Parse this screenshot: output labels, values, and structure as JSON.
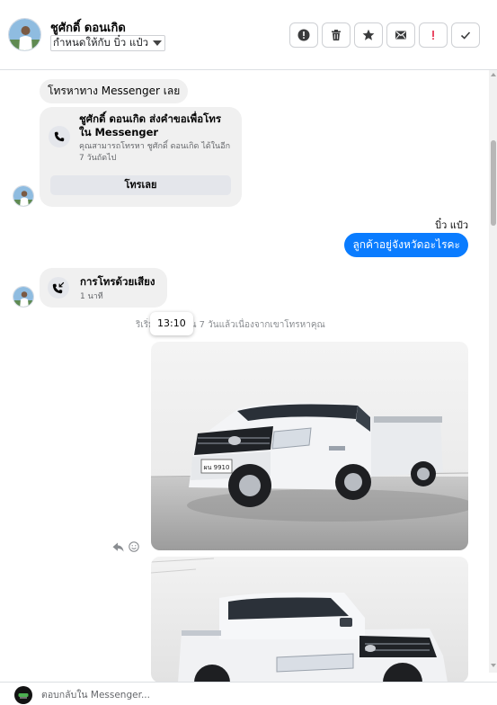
{
  "header": {
    "contact_name": "ชูศักดิ์ ดอนเกิด",
    "assign_label": "กำหนดให้กับ บิ๋ว แป๋ว",
    "actions": [
      {
        "icon": "alert-circle-icon",
        "name": "mark-spam-button"
      },
      {
        "icon": "trash-icon",
        "name": "delete-button"
      },
      {
        "icon": "star-icon",
        "name": "star-button"
      },
      {
        "icon": "mail-unread-icon",
        "name": "mark-unread-button"
      },
      {
        "icon": "exclamation-icon",
        "name": "follow-up-button"
      },
      {
        "icon": "check-icon",
        "name": "mark-done-button"
      }
    ]
  },
  "conversation": {
    "heading_message": "โทรหาทาง Messenger เลย",
    "call_request": {
      "title": "ชูศักดิ์ ดอนเกิด ส่งคำขอเพื่อโทรใน Messenger",
      "description": "คุณสามารถโทรหา ชูศักดิ์ ดอนเกิด ได้ในอีก 7 วันถัดไป",
      "button_label": "โทรเลย"
    },
    "sender_name": "บิ๋ว แป๋ว",
    "outgoing_message": "ลูกค้าอยู่จังหวัดอะไรคะ",
    "voice_call": {
      "title": "การโทรด้วยเสียง",
      "duration": "1 นาที"
    },
    "system_note": "ริเริ่ม... โทรเป็น 7 วันแล้วเนื่องจากเขาโทรหาคุณ",
    "tooltip_time": "13:10",
    "photo1_plate": "ผน 9910"
  },
  "composer": {
    "placeholder": "ตอบกลับใน Messenger..."
  },
  "colors": {
    "accent": "#0a7cff",
    "bubble": "#f0f0f0",
    "muted_text": "#65676b"
  }
}
